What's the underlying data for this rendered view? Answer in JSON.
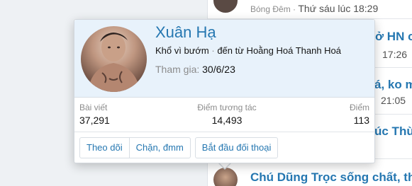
{
  "background_list": {
    "top_item": {
      "author": "Bóng Đêm",
      "separator": " · ",
      "time": "Thứ sáu lúc 18:29"
    },
    "partials": [
      {
        "text": "ở HN c",
        "kind": "title"
      },
      {
        "text": "17:26",
        "kind": "small"
      },
      {
        "text": "á, ko m",
        "kind": "title"
      },
      {
        "text": "21:05",
        "kind": "small"
      },
      {
        "text": "úc Thù",
        "kind": "title"
      }
    ],
    "bottom_item_title": "Chú Dũng Trọc sống chất, thì"
  },
  "member_card": {
    "username": "Xuân Hạ",
    "tagline_title": "Khổ vì bướm",
    "tagline_separator": " · ",
    "tagline_location": "đến từ Hoằng Hoá Thanh Hoá",
    "joined_label": "Tham gia:",
    "joined_date": "30/6/23",
    "stats": {
      "posts_label": "Bài viết",
      "posts_value": "37,291",
      "reactions_label": "Điểm tương tác",
      "reactions_value": "14,493",
      "points_label": "Điểm",
      "points_value": "113"
    },
    "actions": {
      "follow": "Theo dõi",
      "ignore": "Chặn, đmm",
      "start_conversation": "Bắt đầu đối thoại"
    }
  },
  "colors": {
    "link": "#2577b1",
    "card_header_bg": "#e8f2fb",
    "muted_text": "#8c8c8c",
    "page_bg": "#eef1f4"
  }
}
